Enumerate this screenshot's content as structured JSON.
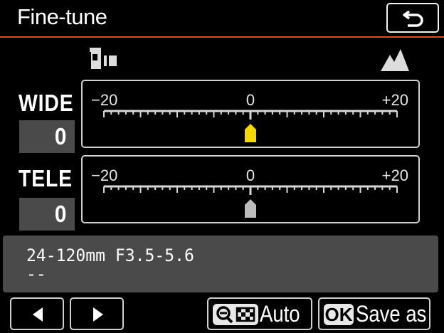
{
  "header": {
    "title": "Fine-tune",
    "back_icon": "return-arrow-icon"
  },
  "icons": {
    "near": "camera-subject-icon",
    "far": "mountain-icon"
  },
  "wide": {
    "label": "WIDE",
    "value": "0",
    "scale_min_label": "−20",
    "scale_mid_label": "0",
    "scale_max_label": "+20",
    "indicator_position": 0,
    "indicator_color": "#f5d800",
    "selected": true
  },
  "tele": {
    "label": "TELE",
    "value": "0",
    "scale_min_label": "−20",
    "scale_mid_label": "0",
    "scale_max_label": "+20",
    "indicator_position": 0,
    "indicator_color": "#bdbdbd",
    "selected": false
  },
  "lens": {
    "name": "24-120mm F3.5-5.6",
    "sub": "--"
  },
  "footer": {
    "prev_icon": "triangle-left-icon",
    "next_icon": "triangle-right-icon",
    "auto_key_icon": "zoom-out-checker-icon",
    "auto_label": "Auto",
    "save_key": "OK",
    "save_label": "Save as"
  },
  "colors": {
    "accent": "#d0502a",
    "panel": "#4a4a4a",
    "highlight": "#f5d800"
  }
}
